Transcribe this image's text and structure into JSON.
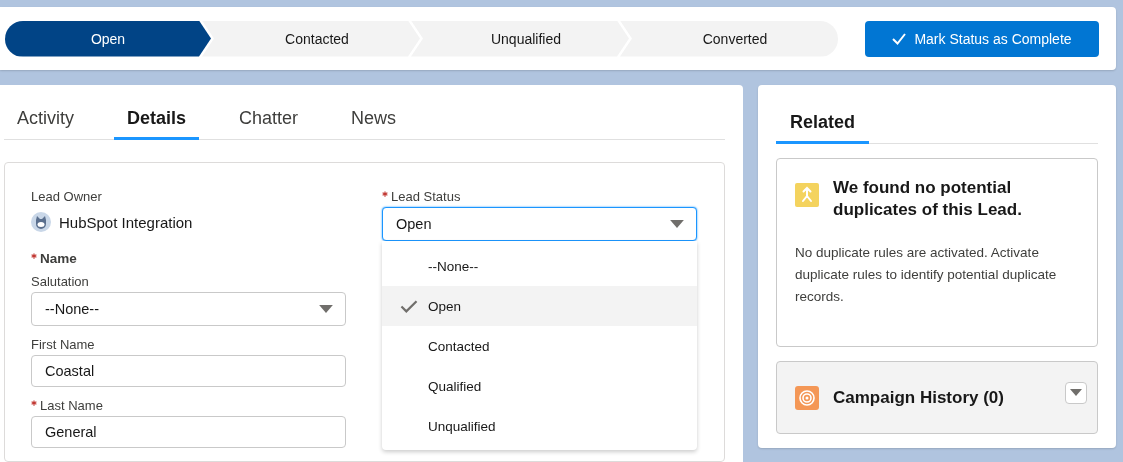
{
  "path": {
    "steps": [
      {
        "label": "Open",
        "selected": true
      },
      {
        "label": "Contacted",
        "selected": false
      },
      {
        "label": "Unqualified",
        "selected": false
      },
      {
        "label": "Converted",
        "selected": false
      }
    ],
    "action": {
      "label": "Mark Status as Complete"
    }
  },
  "detail_tabs": [
    {
      "label": "Activity",
      "selected": false
    },
    {
      "label": "Details",
      "selected": true
    },
    {
      "label": "Chatter",
      "selected": false
    },
    {
      "label": "News",
      "selected": false
    }
  ],
  "lead_owner": {
    "label": "Lead Owner",
    "value": "HubSpot Integration"
  },
  "lead_status": {
    "label": "Lead Status",
    "required": true,
    "value": "Open",
    "expanded": true,
    "options": [
      {
        "label": "--None--",
        "selected": false
      },
      {
        "label": "Open",
        "selected": true
      },
      {
        "label": "Contacted",
        "selected": false
      },
      {
        "label": "Qualified",
        "selected": false
      },
      {
        "label": "Unqualified",
        "selected": false
      }
    ]
  },
  "name": {
    "label": "Name",
    "required": true,
    "fields": [
      {
        "kind": "select",
        "label": "Salutation",
        "required": false,
        "value": "--None--"
      },
      {
        "kind": "text",
        "label": "First Name",
        "required": false,
        "value": "Coastal"
      },
      {
        "kind": "text",
        "label": "Last Name",
        "required": true,
        "value": "General"
      }
    ]
  },
  "related": {
    "tabs": [
      {
        "label": "Related",
        "selected": true
      }
    ],
    "duplicates": {
      "title": "We found no potential duplicates of this Lead.",
      "message": "No duplicate rules are activated. Activate duplicate rules to identify potential duplicate records."
    },
    "campaign_history": {
      "title": "Campaign History (0)"
    }
  }
}
